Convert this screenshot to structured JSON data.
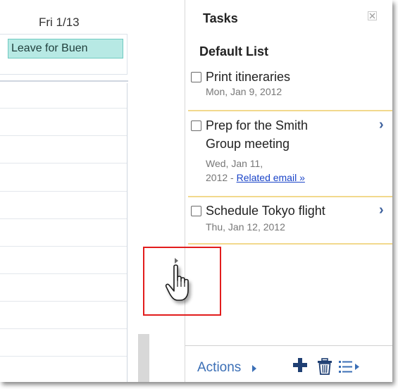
{
  "calendar": {
    "day_header": "Fri 1/13",
    "event_label": "Leave for Buen"
  },
  "tasks_panel": {
    "title": "Tasks",
    "list_name": "Default List",
    "items": [
      {
        "title": "Print itineraries",
        "date": "Mon, Jan 9, 2012"
      },
      {
        "title_line1": "Prep for the Smith",
        "title_line2": "Group meeting",
        "date_line1": "Wed, Jan 11,",
        "date_line2": "2012 -",
        "link": "Related email »"
      },
      {
        "title": "Schedule Tokyo flight",
        "date": "Thu, Jan 12, 2012"
      }
    ],
    "footer": {
      "actions_label": "Actions"
    }
  },
  "icons": [
    "close-icon",
    "chevron-right-icon",
    "collapse-arrow-icon",
    "hand-cursor-icon",
    "add-icon",
    "trash-icon",
    "list-options-icon"
  ],
  "colors": {
    "accent": "#3b6fb6",
    "event_bg": "#b7e9e4",
    "highlight": "#e21d1d",
    "separator": "#f2d98d"
  }
}
